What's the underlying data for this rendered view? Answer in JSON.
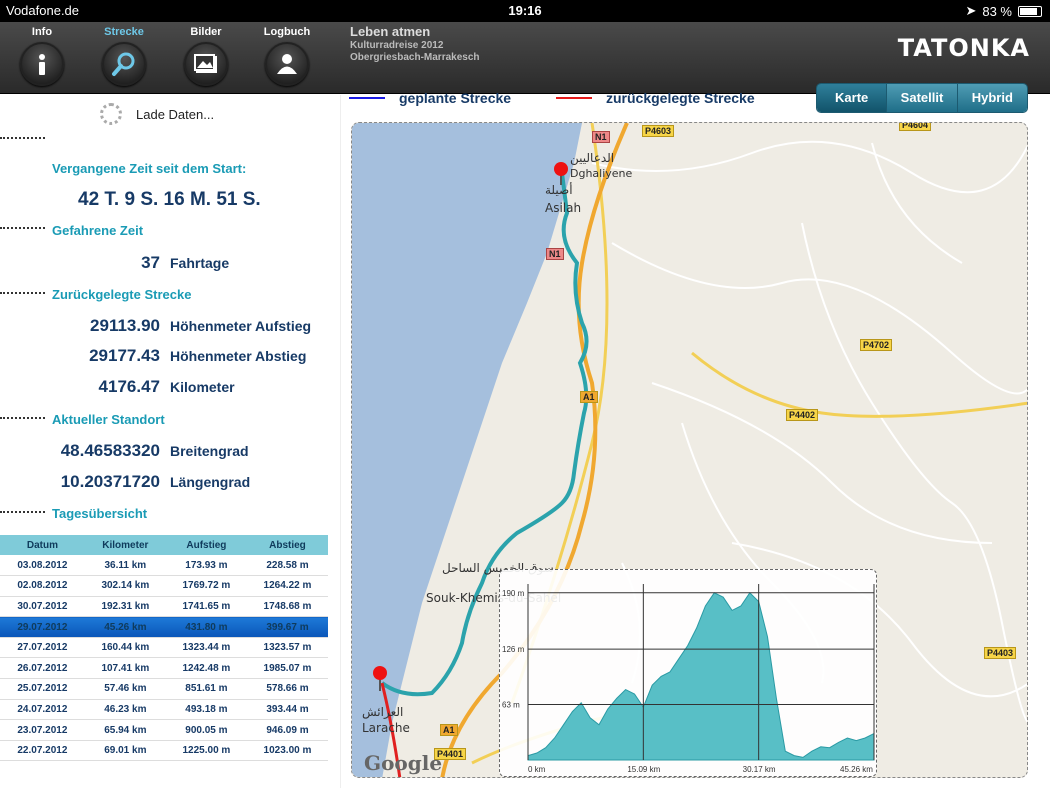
{
  "status_bar": {
    "carrier": "Vodafone.de",
    "time": "19:16",
    "battery": "83 %",
    "battery_level": 0.83
  },
  "nav": [
    {
      "label": "Info",
      "icon": "info-icon"
    },
    {
      "label": "Strecke",
      "icon": "search-icon",
      "active": true
    },
    {
      "label": "Bilder",
      "icon": "picture-icon"
    },
    {
      "label": "Logbuch",
      "icon": "user-icon"
    }
  ],
  "header": {
    "title": "Leben atmen",
    "subtitle1": "Kulturradreise 2012",
    "subtitle2": "Obergriesbach-Marrakesch",
    "logo": "TATONKA"
  },
  "loading_text": "Lade Daten...",
  "stats": {
    "elapsed_label": "Vergangene Zeit seit dem Start:",
    "elapsed_value": "42 T. 9 S. 16 M. 51 S.",
    "ride_time_label": "Gefahrene Zeit",
    "ride_days_value": "37",
    "ride_days_unit": "Fahrtage",
    "distance_label": "Zurückgelegte Strecke",
    "ascent_value": "29113.90",
    "ascent_unit": "Höhenmeter Aufstieg",
    "descent_value": "29177.43",
    "descent_unit": "Höhenmeter Abstieg",
    "km_value": "4176.47",
    "km_unit": "Kilometer",
    "location_label": "Aktueller Standort",
    "lat_value": "48.46583320",
    "lat_unit": "Breitengrad",
    "lon_value": "10.20371720",
    "lon_unit": "Längengrad",
    "daily_label": "Tagesübersicht"
  },
  "table": {
    "headers": [
      "Datum",
      "Kilometer",
      "Aufstieg",
      "Abstieg"
    ],
    "rows": [
      [
        "03.08.2012",
        "36.11 km",
        "173.93 m",
        "228.58 m"
      ],
      [
        "02.08.2012",
        "302.14 km",
        "1769.72 m",
        "1264.22 m"
      ],
      [
        "30.07.2012",
        "192.31 km",
        "1741.65 m",
        "1748.68 m"
      ],
      [
        "29.07.2012",
        "45.26 km",
        "431.80 m",
        "399.67 m"
      ],
      [
        "27.07.2012",
        "160.44 km",
        "1323.44 m",
        "1323.57 m"
      ],
      [
        "26.07.2012",
        "107.41 km",
        "1242.48 m",
        "1985.07 m"
      ],
      [
        "25.07.2012",
        "57.46 km",
        "851.61 m",
        "578.66 m"
      ],
      [
        "24.07.2012",
        "46.23 km",
        "493.18 m",
        "393.44 m"
      ],
      [
        "23.07.2012",
        "65.94 km",
        "900.05 m",
        "946.09 m"
      ],
      [
        "22.07.2012",
        "69.01 km",
        "1225.00 m",
        "1023.00 m"
      ]
    ],
    "selected_index": 3
  },
  "legend": {
    "planned": "geplante Strecke",
    "planned_color": "#1a1ae6",
    "traveled": "zurückgelegte Strecke",
    "traveled_color": "#e61a1a"
  },
  "map_types": [
    "Karte",
    "Satellit",
    "Hybrid"
  ],
  "map": {
    "places": {
      "asilah_ar": "أصيلة",
      "asilah": "Asilah",
      "dghaliyene_ar": "الدعاليين",
      "dghaliyene": "Dghaliyene",
      "souk_ar": "سوق الخميس الساحل",
      "souk": "Souk-Khemis-du-Sahel",
      "larache_ar": "العرائش",
      "larache": "Larache"
    },
    "roads": {
      "p4603": "P4603",
      "p4604": "P4604",
      "p4702": "P4702",
      "p4402": "P4402",
      "p4403": "P4403",
      "p4401": "P4401",
      "a1": "A1",
      "n1": "N1"
    },
    "google": "Google"
  },
  "elevation": {
    "y_ticks": [
      "190 m",
      "126 m",
      "63 m"
    ],
    "x_ticks": [
      "0 km",
      "15.09 km",
      "30.17 km",
      "45.26 km"
    ],
    "profile": [
      5,
      8,
      14,
      25,
      40,
      55,
      65,
      48,
      40,
      58,
      70,
      80,
      75,
      60,
      85,
      95,
      100,
      115,
      130,
      150,
      175,
      190,
      185,
      170,
      175,
      190,
      180,
      140,
      70,
      10,
      5,
      3,
      10,
      15,
      14,
      20,
      25,
      22,
      25,
      30
    ],
    "max": 200,
    "fill_color": "#58bfc6"
  }
}
